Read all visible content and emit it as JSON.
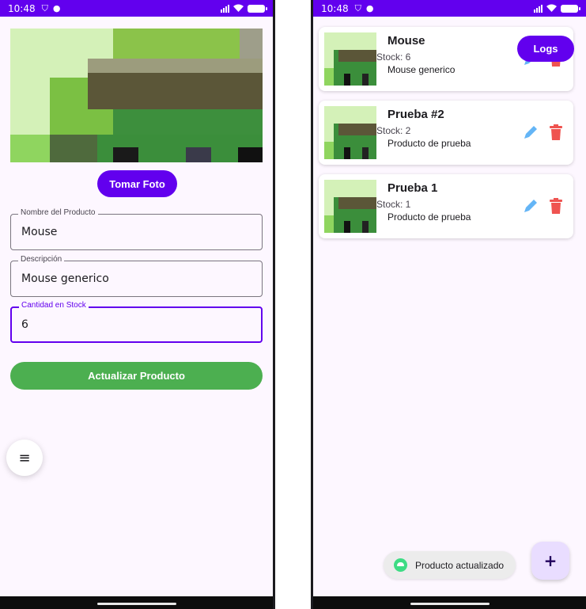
{
  "status_bar": {
    "time": "10:48"
  },
  "edit_screen": {
    "take_photo_label": "Tomar Foto",
    "fields": [
      {
        "label": "Nombre del Producto",
        "value": "Mouse"
      },
      {
        "label": "Descripción",
        "value": "Mouse generico"
      },
      {
        "label": "Cantidad en Stock",
        "value": "6"
      }
    ],
    "update_label": "Actualizar Producto",
    "menu_icon": "≡"
  },
  "list_screen": {
    "logs_label": "Logs",
    "products": [
      {
        "name": "Mouse",
        "stock": "Stock: 6",
        "description": "Mouse generico"
      },
      {
        "name": "Prueba #2",
        "stock": "Stock: 2",
        "description": "Producto de prueba"
      },
      {
        "name": "Prueba 1",
        "stock": "Stock: 1",
        "description": "Producto de prueba"
      }
    ],
    "toast": "Producto actualizado",
    "add_icon": "+"
  },
  "colors": {
    "primary": "#6200ee",
    "success": "#4caf50",
    "edit_icon": "#64b5f6",
    "delete_icon": "#ef5350"
  },
  "icons": [
    "location-icon",
    "alert-icon",
    "signal-icon",
    "wifi-icon",
    "battery-icon",
    "menu-icon",
    "edit-icon",
    "trash-icon",
    "android-icon",
    "plus-icon"
  ]
}
